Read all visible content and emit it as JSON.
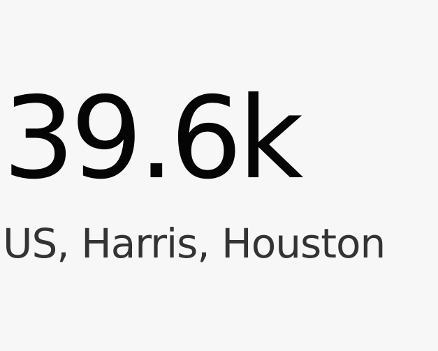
{
  "metric": {
    "value": "39.6k",
    "label": "US, Harris, Houston"
  },
  "colors": {
    "background": "#f7f7f7",
    "value_text": "#050505",
    "label_text": "#333333"
  }
}
